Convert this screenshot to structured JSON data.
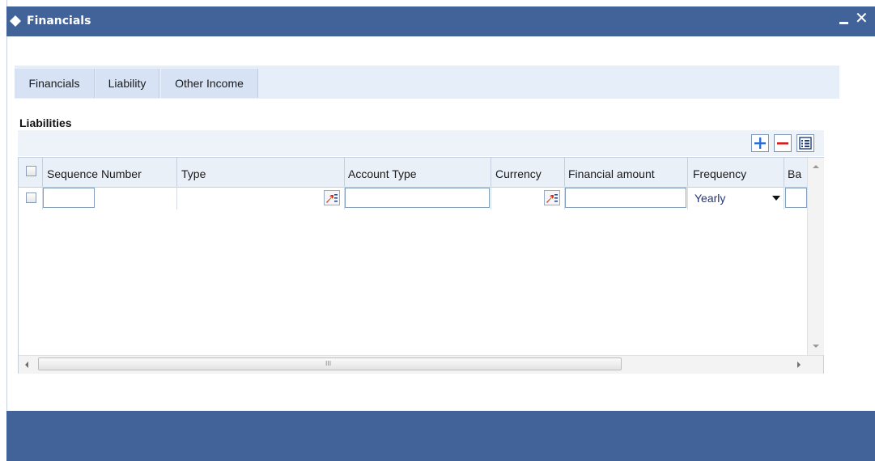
{
  "window": {
    "title": "Financials",
    "icons": {
      "title": "diamond-icon",
      "minimize": "minimize-icon",
      "close": "close-icon"
    },
    "close_glyph": "✕"
  },
  "tabs": [
    {
      "label": "Financials"
    },
    {
      "label": "Liability"
    },
    {
      "label": "Other Income"
    }
  ],
  "section": {
    "title": "Liabilities"
  },
  "toolbar": {
    "add_icon": "plus-icon",
    "remove_icon": "minus-icon",
    "view_icon": "list-view-icon"
  },
  "grid": {
    "columns": [
      "Sequence Number",
      "Type",
      "Account Type",
      "Currency",
      "Financial amount",
      "Frequency",
      "Ba"
    ],
    "rows": [
      {
        "sequence_number": "",
        "type": "",
        "account_type": "",
        "currency": "",
        "financial_amount": "",
        "frequency": "Yearly",
        "balance": ""
      }
    ],
    "hscroll_thumb_glyph": "III"
  },
  "colors": {
    "title_bar": "#42639a",
    "tab_bar": "#e6eefa",
    "tab": "#d7e3f4",
    "footer": "#42639a"
  }
}
